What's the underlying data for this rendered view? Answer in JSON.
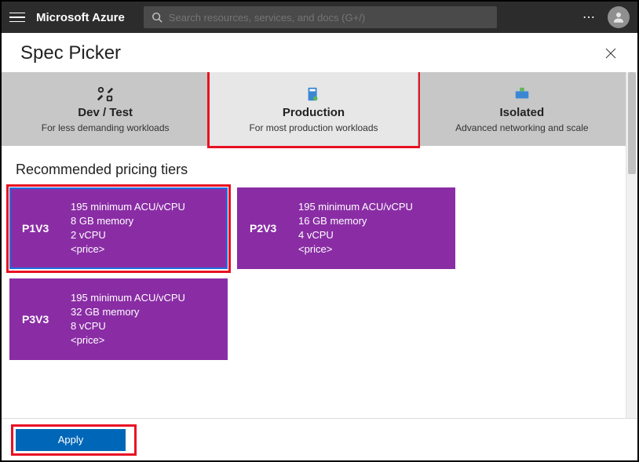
{
  "topbar": {
    "brand": "Microsoft Azure",
    "search_placeholder": "Search resources, services, and docs (G+/)",
    "more": "⋯"
  },
  "page": {
    "title": "Spec Picker"
  },
  "tabs": [
    {
      "id": "devtest",
      "title": "Dev / Test",
      "subtitle": "For less demanding workloads",
      "selected": false
    },
    {
      "id": "production",
      "title": "Production",
      "subtitle": "For most production workloads",
      "selected": true
    },
    {
      "id": "isolated",
      "title": "Isolated",
      "subtitle": "Advanced networking and scale",
      "selected": false
    }
  ],
  "section": {
    "title": "Recommended pricing tiers"
  },
  "tiers": [
    {
      "name": "P1V3",
      "acu": "195 minimum ACU/vCPU",
      "memory": "8 GB memory",
      "vcpu": "2 vCPU",
      "price": "<price>",
      "selected": true
    },
    {
      "name": "P2V3",
      "acu": "195 minimum ACU/vCPU",
      "memory": "16 GB memory",
      "vcpu": "4 vCPU",
      "price": "<price>",
      "selected": false
    },
    {
      "name": "P3V3",
      "acu": "195 minimum ACU/vCPU",
      "memory": "32 GB memory",
      "vcpu": "8 vCPU",
      "price": "<price>",
      "selected": false
    }
  ],
  "footer": {
    "apply_label": "Apply"
  },
  "colors": {
    "tier_bg": "#8a2da5",
    "apply_bg": "#0067b8",
    "highlight": "#e81123"
  }
}
